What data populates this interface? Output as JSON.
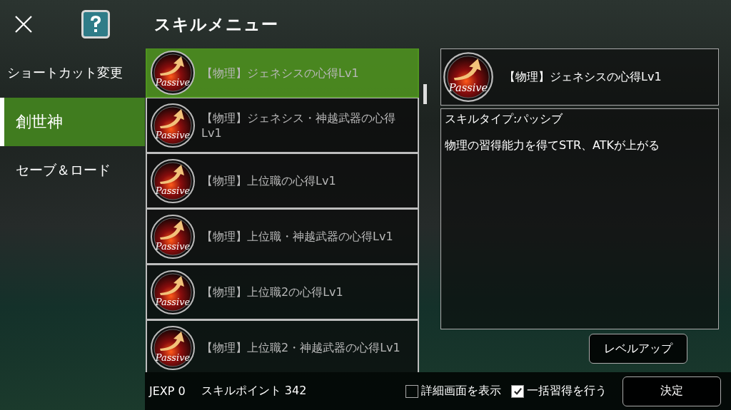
{
  "header": {
    "title": "スキルメニュー"
  },
  "sidebar": {
    "items": [
      {
        "label": "ショートカット変更",
        "selected": false
      },
      {
        "label": "創世神",
        "selected": true
      },
      {
        "label": "セーブ＆ロード",
        "selected": false
      }
    ]
  },
  "skills": [
    {
      "icon_text": "Passive",
      "name": "【物理】ジェネシスの心得Lv1",
      "selected": true
    },
    {
      "icon_text": "Passive",
      "name": "【物理】ジェネシス・神越武器の心得Lv1",
      "selected": false
    },
    {
      "icon_text": "Passive",
      "name": "【物理】上位職の心得Lv1",
      "selected": false
    },
    {
      "icon_text": "Passive",
      "name": "【物理】上位職・神越武器の心得Lv1",
      "selected": false
    },
    {
      "icon_text": "Passive",
      "name": "【物理】上位職2の心得Lv1",
      "selected": false
    },
    {
      "icon_text": "Passive",
      "name": "【物理】上位職2・神越武器の心得Lv1",
      "selected": false
    }
  ],
  "detail": {
    "icon_text": "Passive",
    "name": "【物理】ジェネシスの心得Lv1",
    "type": "スキルタイプ:パッシブ",
    "description": "物理の習得能力を得てSTR、ATKが上がる",
    "button": "レベルアップ"
  },
  "footer": {
    "jexp": "JEXP 0",
    "skill_points": "スキルポイント 342",
    "options": [
      {
        "label": "詳細画面を表示",
        "checked": false
      },
      {
        "label": "一括習得を行う",
        "checked": true
      }
    ],
    "confirm": "決定"
  }
}
